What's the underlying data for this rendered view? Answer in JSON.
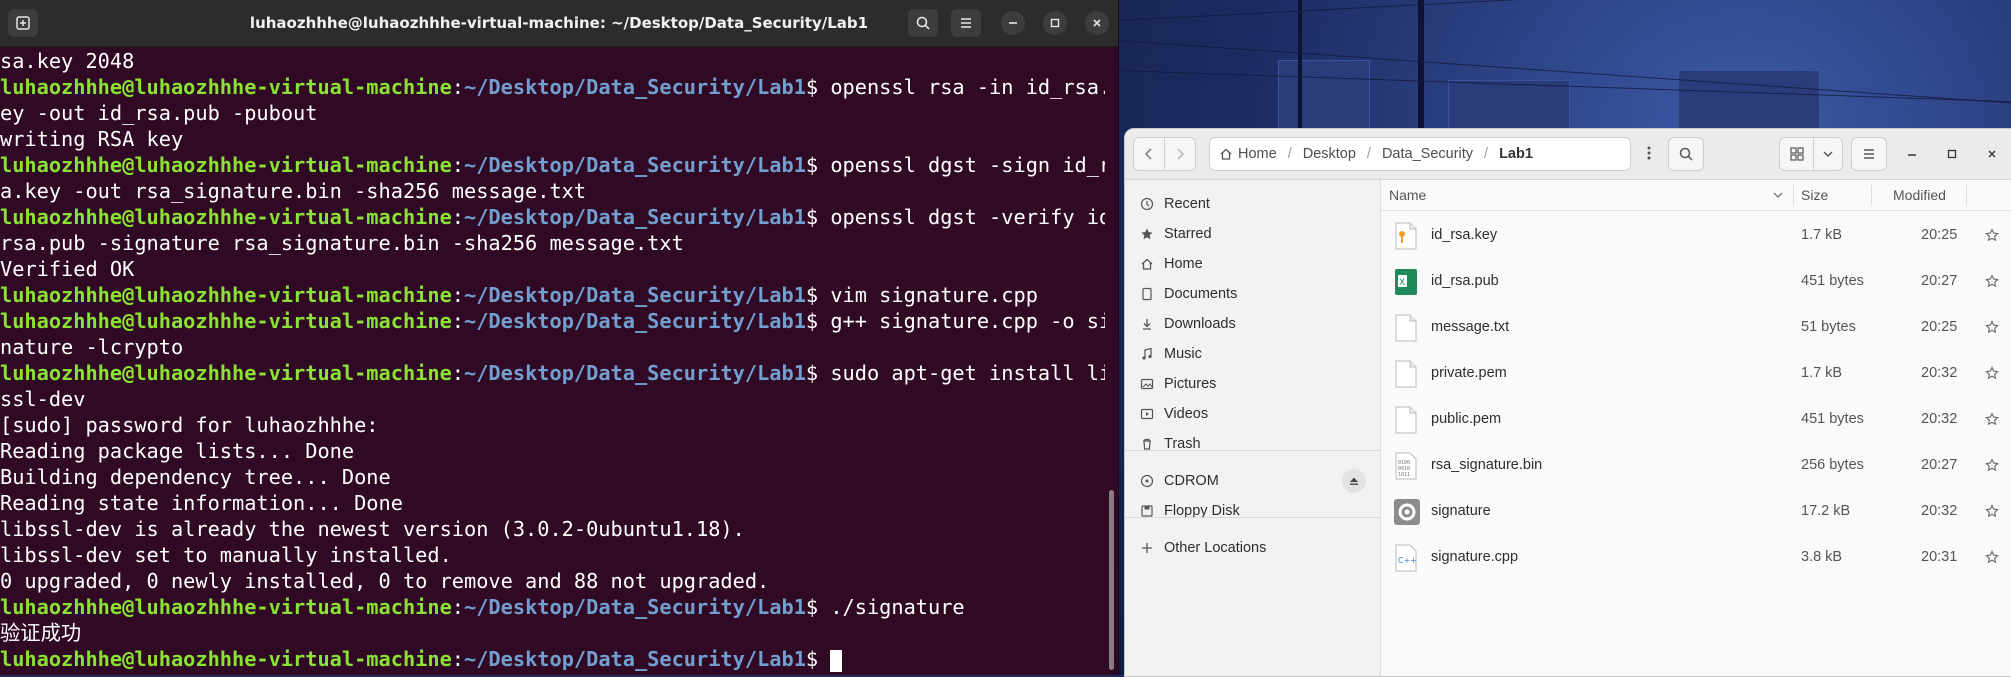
{
  "terminal": {
    "title": "luhaozhhhe@luhaozhhhe-virtual-machine: ~/Desktop/Data_Security/Lab1",
    "lines": [
      {
        "t": "plain",
        "text": "sa.key 2048"
      },
      {
        "t": "prompt",
        "user": "luhaozhhhe@luhaozhhhe-virtual-machine",
        "path": "~/Desktop/Data_Security/Lab1",
        "cmd": "$ openssl rsa -in id_rsa.k"
      },
      {
        "t": "plain",
        "text": "ey -out id_rsa.pub -pubout"
      },
      {
        "t": "plain",
        "text": "writing RSA key"
      },
      {
        "t": "prompt",
        "user": "luhaozhhhe@luhaozhhhe-virtual-machine",
        "path": "~/Desktop/Data_Security/Lab1",
        "cmd": "$ openssl dgst -sign id_rs"
      },
      {
        "t": "plain",
        "text": "a.key -out rsa_signature.bin -sha256 message.txt"
      },
      {
        "t": "prompt",
        "user": "luhaozhhhe@luhaozhhhe-virtual-machine",
        "path": "~/Desktop/Data_Security/Lab1",
        "cmd": "$ openssl dgst -verify id_"
      },
      {
        "t": "plain",
        "text": "rsa.pub -signature rsa_signature.bin -sha256 message.txt"
      },
      {
        "t": "plain",
        "text": "Verified OK"
      },
      {
        "t": "prompt",
        "user": "luhaozhhhe@luhaozhhhe-virtual-machine",
        "path": "~/Desktop/Data_Security/Lab1",
        "cmd": "$ vim signature.cpp"
      },
      {
        "t": "prompt",
        "user": "luhaozhhhe@luhaozhhhe-virtual-machine",
        "path": "~/Desktop/Data_Security/Lab1",
        "cmd": "$ g++ signature.cpp -o sig"
      },
      {
        "t": "plain",
        "text": "nature -lcrypto"
      },
      {
        "t": "prompt",
        "user": "luhaozhhhe@luhaozhhhe-virtual-machine",
        "path": "~/Desktop/Data_Security/Lab1",
        "cmd": "$ sudo apt-get install lib"
      },
      {
        "t": "plain",
        "text": "ssl-dev"
      },
      {
        "t": "plain",
        "text": "[sudo] password for luhaozhhhe:"
      },
      {
        "t": "plain",
        "text": "Reading package lists... Done"
      },
      {
        "t": "plain",
        "text": "Building dependency tree... Done"
      },
      {
        "t": "plain",
        "text": "Reading state information... Done"
      },
      {
        "t": "plain",
        "text": "libssl-dev is already the newest version (3.0.2-0ubuntu1.18)."
      },
      {
        "t": "plain",
        "text": "libssl-dev set to manually installed."
      },
      {
        "t": "plain",
        "text": "0 upgraded, 0 newly installed, 0 to remove and 88 not upgraded."
      },
      {
        "t": "prompt",
        "user": "luhaozhhhe@luhaozhhhe-virtual-machine",
        "path": "~/Desktop/Data_Security/Lab1",
        "cmd": "$ ./signature"
      },
      {
        "t": "plain",
        "text": "验证成功"
      },
      {
        "t": "prompt",
        "user": "luhaozhhhe@luhaozhhhe-virtual-machine",
        "path": "~/Desktop/Data_Security/Lab1",
        "cmd": "$ ",
        "cursor": true
      }
    ]
  },
  "files": {
    "breadcrumb": [
      "Home",
      "Desktop",
      "Data_Security",
      "Lab1"
    ],
    "sidebar": [
      {
        "label": "Recent",
        "icon": "clock-icon"
      },
      {
        "label": "Starred",
        "icon": "star-icon"
      },
      {
        "label": "Home",
        "icon": "home-icon"
      },
      {
        "label": "Documents",
        "icon": "document-icon"
      },
      {
        "label": "Downloads",
        "icon": "download-icon"
      },
      {
        "label": "Music",
        "icon": "music-icon"
      },
      {
        "label": "Pictures",
        "icon": "picture-icon"
      },
      {
        "label": "Videos",
        "icon": "video-icon"
      },
      {
        "label": "Trash",
        "icon": "trash-icon"
      },
      {
        "label": "CDROM",
        "icon": "disc-icon"
      },
      {
        "label": "Floppy Disk",
        "icon": "floppy-icon"
      },
      {
        "label": "Other Locations",
        "icon": "plus-icon"
      }
    ],
    "columns": {
      "name": "Name",
      "size": "Size",
      "modified": "Modified"
    },
    "rows": [
      {
        "name": "id_rsa.key",
        "size": "1.7 kB",
        "modified": "20:25",
        "kind": "key"
      },
      {
        "name": "id_rsa.pub",
        "size": "451 bytes",
        "modified": "20:27",
        "kind": "pub"
      },
      {
        "name": "message.txt",
        "size": "51 bytes",
        "modified": "20:25",
        "kind": "text"
      },
      {
        "name": "private.pem",
        "size": "1.7 kB",
        "modified": "20:32",
        "kind": "text"
      },
      {
        "name": "public.pem",
        "size": "451 bytes",
        "modified": "20:32",
        "kind": "text"
      },
      {
        "name": "rsa_signature.bin",
        "size": "256 bytes",
        "modified": "20:27",
        "kind": "binary"
      },
      {
        "name": "signature",
        "size": "17.2 kB",
        "modified": "20:32",
        "kind": "exec"
      },
      {
        "name": "signature.cpp",
        "size": "3.8 kB",
        "modified": "20:31",
        "kind": "cpp"
      }
    ],
    "colors": {
      "terminal_bg": "#300a24",
      "prompt_user": "#8ae234",
      "prompt_path": "#729fcf"
    }
  }
}
